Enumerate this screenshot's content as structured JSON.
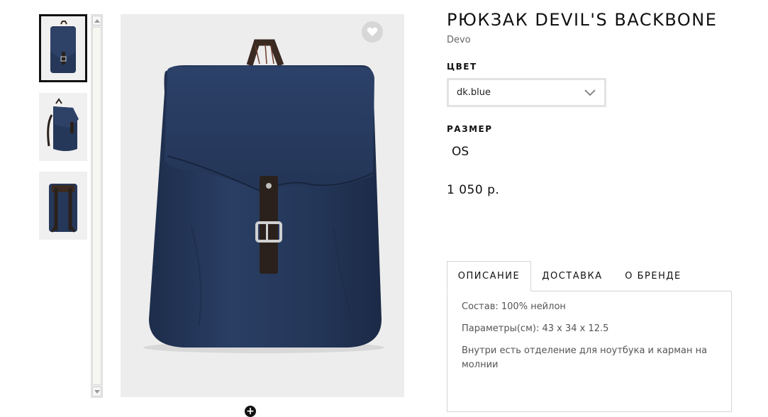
{
  "product": {
    "title": "РЮКЗАК DEVIL'S BACKBONE",
    "brand": "Devo",
    "color_label": "ЦВЕТ",
    "color_value": "dk.blue",
    "size_label": "РАЗМЕР",
    "size_value": "OS",
    "price": "1 050 р."
  },
  "gallery": {
    "thumbnails": [
      {
        "view": "front",
        "selected": true
      },
      {
        "view": "side",
        "selected": false
      },
      {
        "view": "back",
        "selected": false
      }
    ],
    "main_image_view": "front"
  },
  "tabs": [
    {
      "label": "ОПИСАНИЕ",
      "active": true
    },
    {
      "label": "ДОСТАВКА",
      "active": false
    },
    {
      "label": "О БРЕНДЕ",
      "active": false
    }
  ],
  "description": {
    "composition": "Состав: 100% нейлон",
    "parameters": "Параметры(см): 43 x 34 x 12.5",
    "details": "Внутри есть отделение для ноутбука и карман на молнии"
  },
  "colors": {
    "bag": "#26385a",
    "strap": "#2a211c",
    "background": "#ededed"
  }
}
